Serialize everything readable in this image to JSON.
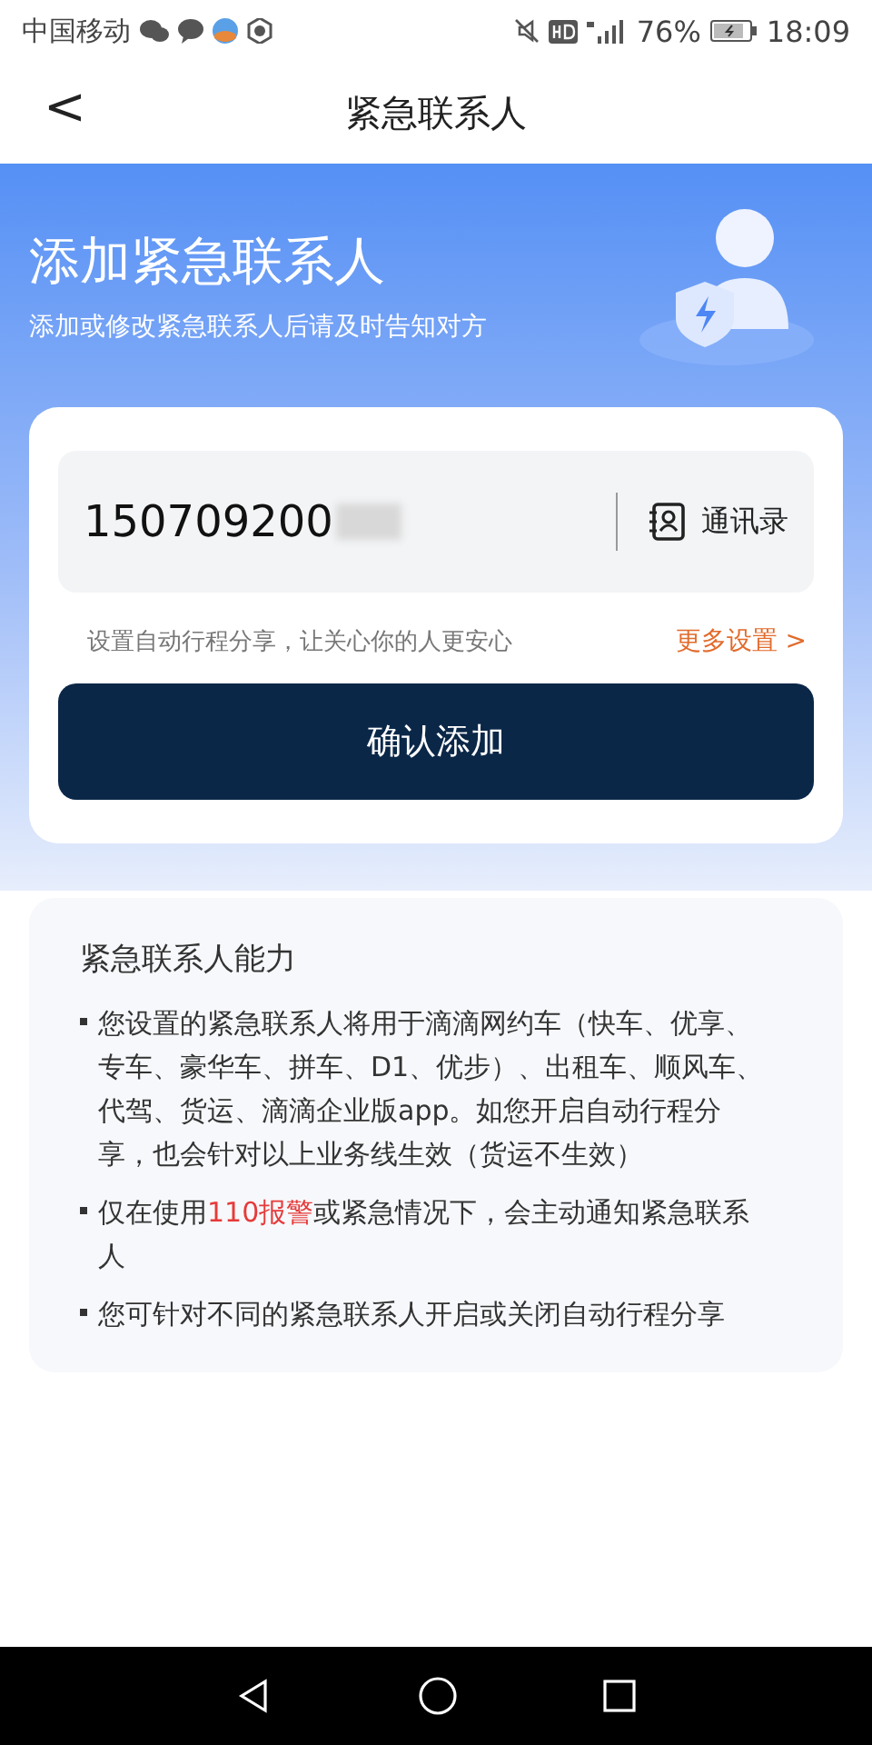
{
  "status_bar": {
    "carrier": "中国移动",
    "battery": "76%",
    "time": "18:09"
  },
  "header": {
    "back": "<",
    "title": "紧急联系人"
  },
  "banner": {
    "title": "添加紧急联系人",
    "subtitle": "添加或修改紧急联系人后请及时告知对方"
  },
  "form": {
    "phone": {
      "value": "150709200"
    },
    "contacts_button": "通讯录",
    "hint": "设置自动行程分享，让关心你的人更安心",
    "more_link": "更多设置",
    "more_arrow": ">",
    "confirm_button": "确认添加"
  },
  "info": {
    "title": "紧急联系人能力",
    "bullets": [
      [
        {
          "text": "您设置的紧急联系人将用于滴滴网约车（快车、优享、专车、豪华车、拼车、D1、优步）、出租车、顺风车、代驾、货运、滴滴企业版app。如您开启自动行程分享，也会针对以上业务线生效（货运不生效）",
          "highlight": false
        }
      ],
      [
        {
          "text": "仅在使用",
          "highlight": false
        },
        {
          "text": "110报警",
          "highlight": true
        },
        {
          "text": "或紧急情况下，会主动通知紧急联系人",
          "highlight": false
        }
      ],
      [
        {
          "text": "您可针对不同的紧急联系人开启或关闭自动行程分享",
          "highlight": false
        }
      ]
    ]
  }
}
